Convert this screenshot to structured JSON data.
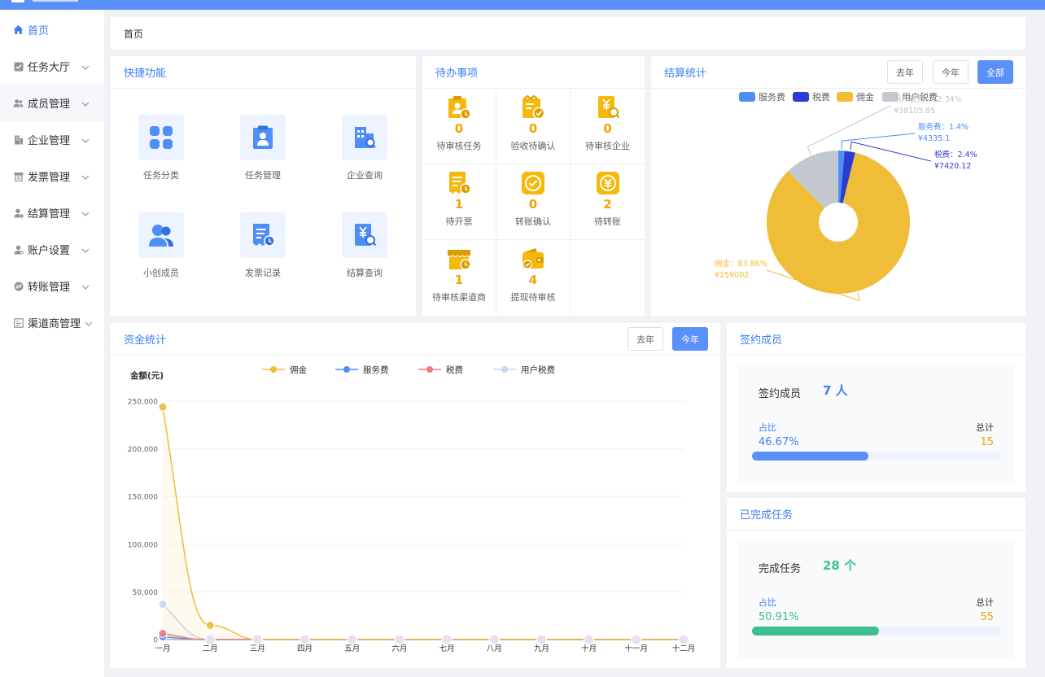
{
  "sidebar": {
    "items": [
      {
        "label": "首页",
        "icon": "home-icon"
      },
      {
        "label": "任务大厅",
        "icon": "checkbox-icon"
      },
      {
        "label": "成员管理",
        "icon": "users-icon"
      },
      {
        "label": "企业管理",
        "icon": "building-icon"
      },
      {
        "label": "发票管理",
        "icon": "invoice-icon"
      },
      {
        "label": "结算管理",
        "icon": "settlement-icon"
      },
      {
        "label": "账户设置",
        "icon": "account-icon"
      },
      {
        "label": "转账管理",
        "icon": "transfer-icon"
      },
      {
        "label": "渠道商管理",
        "icon": "channel-icon"
      }
    ]
  },
  "breadcrumb": {
    "home": "首页"
  },
  "quick": {
    "title": "快捷功能",
    "items": [
      {
        "label": "任务分类",
        "icon": "grid-icon"
      },
      {
        "label": "任务管理",
        "icon": "clipboard-icon"
      },
      {
        "label": "企业查询",
        "icon": "building-search-icon"
      },
      {
        "label": "小创成员",
        "icon": "members-icon"
      },
      {
        "label": "发票记录",
        "icon": "invoice-record-icon"
      },
      {
        "label": "结算查询",
        "icon": "settlement-search-icon"
      }
    ]
  },
  "todo": {
    "title": "待办事项",
    "items": [
      {
        "count": "0",
        "label": "待审核任务"
      },
      {
        "count": "0",
        "label": "验收待确认"
      },
      {
        "count": "0",
        "label": "待审核企业"
      },
      {
        "count": "1",
        "label": "待开票"
      },
      {
        "count": "0",
        "label": "转账确认"
      },
      {
        "count": "2",
        "label": "待转账"
      },
      {
        "count": "1",
        "label": "待审核渠道商"
      },
      {
        "count": "4",
        "label": "提现待审核"
      }
    ]
  },
  "settlement": {
    "title": "结算统计",
    "buttons": {
      "last_year": "去年",
      "this_year": "今年",
      "all": "全部"
    },
    "legend": [
      "服务费",
      "税费",
      "佣金",
      "用户税费"
    ],
    "labels": {
      "user_tax_pct": "用户税费：12.34%",
      "user_tax_amt": "¥38105.85",
      "service_pct": "服务费：1.4%",
      "service_amt": "¥4335.1",
      "tax_pct": "税费：2.4%",
      "tax_amt": "¥7420.12",
      "commission_pct": "佣金：83.86%",
      "commission_amt": "¥259002"
    }
  },
  "fund": {
    "title": "资金统计",
    "buttons": {
      "last_year": "去年",
      "this_year": "今年"
    }
  },
  "members": {
    "title": "签约成员",
    "stat_label": "签约成员",
    "stat_value": "7 人",
    "ratio_label": "占比",
    "total_label": "总计",
    "ratio": "46.67%",
    "total": "15"
  },
  "done": {
    "title": "已完成任务",
    "stat_label": "完成任务",
    "stat_value": "28 个",
    "ratio_label": "占比",
    "total_label": "总计",
    "ratio": "50.91%",
    "total": "55"
  },
  "colors": {
    "primary": "#5b8ff9",
    "commission": "#f0bd38",
    "service": "#4e8ef7",
    "tax": "#2b3dd1",
    "user_tax": "#c4c8cf",
    "green": "#3cc08e",
    "tax_line": "#f07c7c",
    "user_tax_line": "#c9d4ea"
  },
  "chart_data": [
    {
      "type": "pie",
      "title": "结算统计",
      "donut": true,
      "legend_position": "top",
      "slices": [
        {
          "name": "服务费",
          "value": 4335.1,
          "percent": 1.4
        },
        {
          "name": "税费",
          "value": 7420.12,
          "percent": 2.4
        },
        {
          "name": "佣金",
          "value": 259002,
          "percent": 83.86
        },
        {
          "name": "用户税费",
          "value": 38105.85,
          "percent": 12.34
        }
      ]
    },
    {
      "type": "area",
      "title": "资金统计",
      "ylabel": "金额(元)",
      "ylim": [
        0,
        250000
      ],
      "yticks": [
        "0",
        "50,000",
        "100,000",
        "150,000",
        "200,000",
        "250,000"
      ],
      "grid": true,
      "legend_position": "top",
      "categories": [
        "一月",
        "二月",
        "三月",
        "四月",
        "五月",
        "六月",
        "七月",
        "八月",
        "九月",
        "十月",
        "十一月",
        "十二月"
      ],
      "series": [
        {
          "name": "佣金",
          "values": [
            244000,
            15000,
            0,
            0,
            0,
            0,
            0,
            0,
            0,
            0,
            0,
            0
          ]
        },
        {
          "name": "服务费",
          "values": [
            3000,
            0,
            0,
            0,
            0,
            0,
            0,
            0,
            0,
            0,
            0,
            0
          ]
        },
        {
          "name": "税费",
          "values": [
            6500,
            0,
            0,
            0,
            0,
            0,
            0,
            0,
            0,
            0,
            0,
            0
          ]
        },
        {
          "name": "用户税费",
          "values": [
            37000,
            0,
            0,
            0,
            0,
            0,
            0,
            0,
            0,
            0,
            0,
            0
          ]
        }
      ]
    }
  ]
}
